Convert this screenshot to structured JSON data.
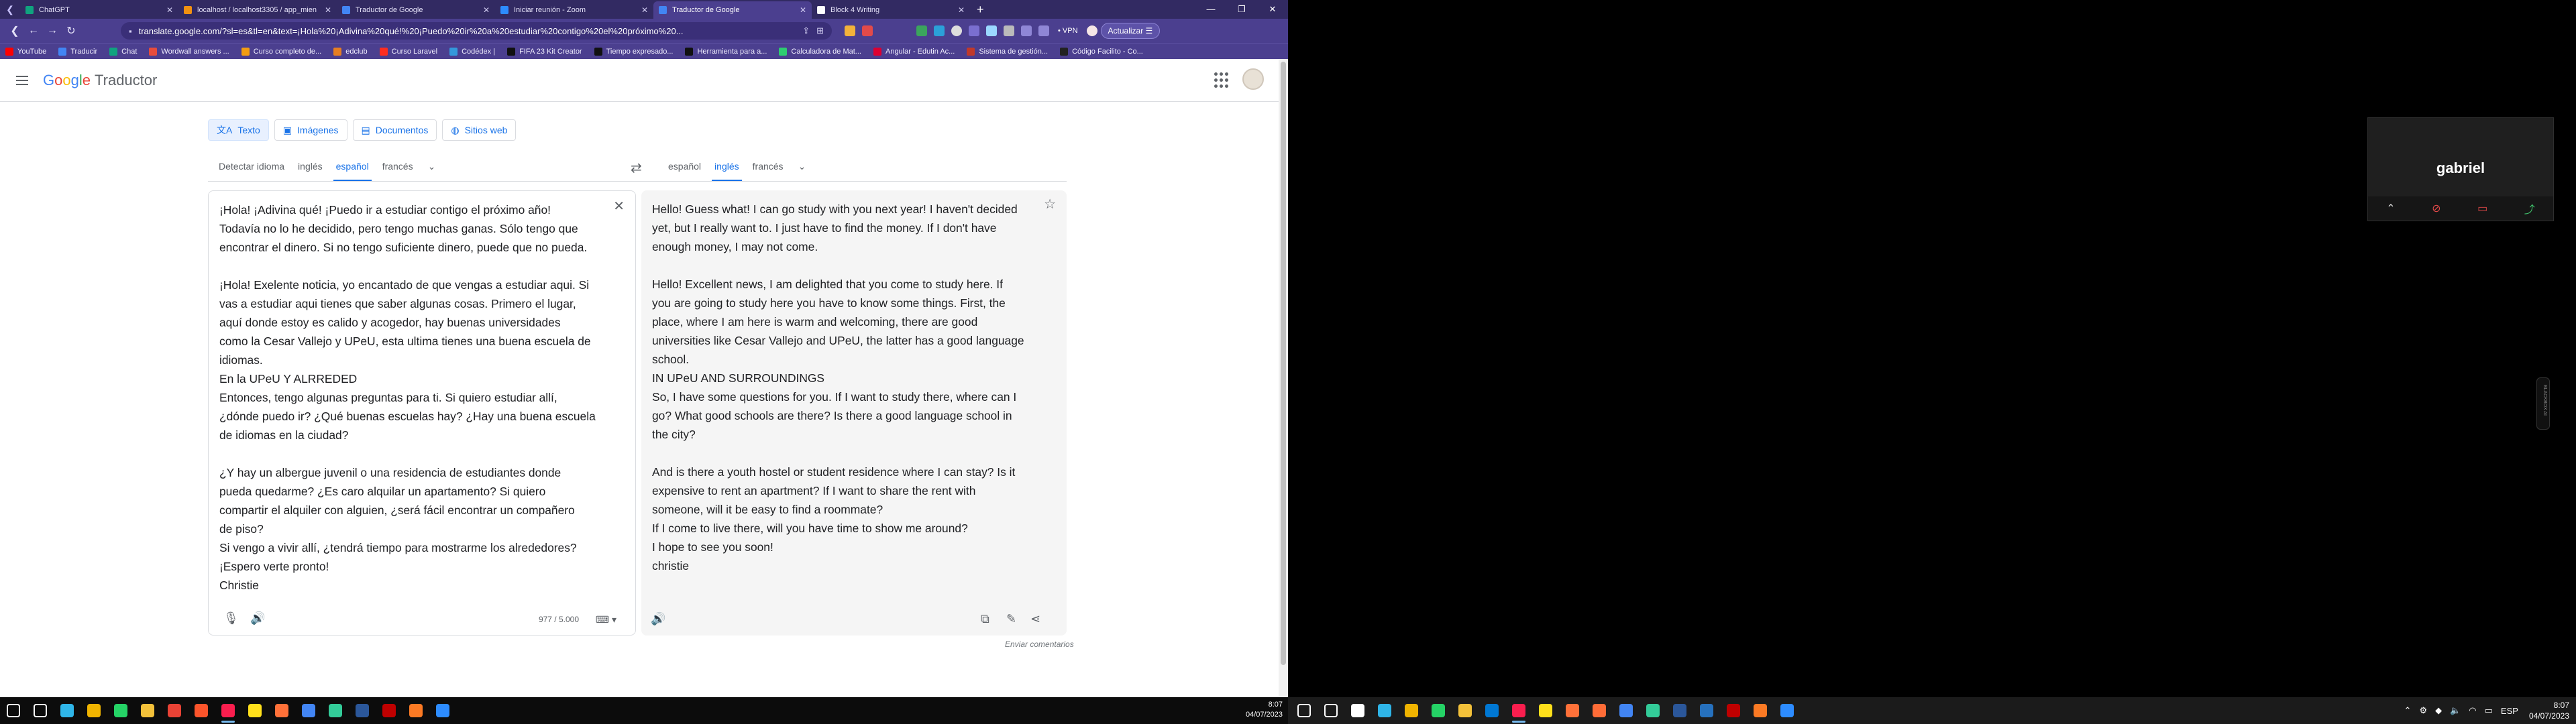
{
  "browser": {
    "tabs": [
      {
        "title": "ChatGPT",
        "color": "#10a37f",
        "active": false
      },
      {
        "title": "localhost / localhost3305 / app_mien",
        "color": "#f29111",
        "active": false
      },
      {
        "title": "Traductor de Google",
        "color": "#4285f4",
        "active": false
      },
      {
        "title": "Iniciar reunión - Zoom",
        "color": "#2d8cff",
        "active": false
      },
      {
        "title": "Traductor de Google",
        "color": "#4285f4",
        "active": true
      },
      {
        "title": "Block 4 Writing",
        "color": "#ffffff",
        "active": false
      }
    ],
    "url": "translate.google.com/?sl=es&tl=en&text=¡Hola%20¡Adivina%20qué!%20¡Puedo%20ir%20a%20estudiar%20contigo%20el%20próximo%20...",
    "vpn_label": "• VPN",
    "update_label": "Actualizar",
    "bookmarks": [
      {
        "label": "YouTube",
        "color": "#ff0000"
      },
      {
        "label": "Traducir",
        "color": "#4285f4"
      },
      {
        "label": "Chat",
        "color": "#10a37f"
      },
      {
        "label": "Wordwall answers ...",
        "color": "#e74c3c"
      },
      {
        "label": "Curso completo de...",
        "color": "#f39c12"
      },
      {
        "label": "edclub",
        "color": "#e67e22"
      },
      {
        "label": "Curso Laravel",
        "color": "#ff2d20"
      },
      {
        "label": "Codédex |",
        "color": "#3498db"
      },
      {
        "label": "FIFA 23 Kit Creator",
        "color": "#111111"
      },
      {
        "label": "Tiempo expresado...",
        "color": "#111111"
      },
      {
        "label": "Herramienta para a...",
        "color": "#111111"
      },
      {
        "label": "Calculadora de Mat...",
        "color": "#2ecc71"
      },
      {
        "label": "Angular - Edutin Ac...",
        "color": "#dd0031"
      },
      {
        "label": "Sistema de gestión...",
        "color": "#c0392b"
      },
      {
        "label": "Código Facilito - Co...",
        "color": "#222222"
      }
    ]
  },
  "gt": {
    "logo": {
      "g": "G",
      "o1": "o",
      "o2": "o",
      "g2": "g",
      "l": "l",
      "e": "e",
      "product": "Traductor"
    },
    "modes": [
      "Texto",
      "Imágenes",
      "Documentos",
      "Sitios web"
    ],
    "source_langs": [
      "Detectar idioma",
      "inglés",
      "español",
      "francés"
    ],
    "target_langs": [
      "español",
      "inglés",
      "francés"
    ],
    "source_text": "¡Hola! ¡Adivina qué! ¡Puedo ir a estudiar contigo el próximo año!\nTodavía no lo he decidido, pero tengo muchas ganas. Sólo tengo que\nencontrar el dinero. Si no tengo suficiente dinero, puede que no pueda.\n\n¡Hola! Exelente noticia, yo encantado de que vengas a estudiar aqui. Si\nvas a estudiar aqui tienes que saber algunas cosas. Primero el lugar,\naquí donde estoy es calido y acogedor, hay buenas universidades\ncomo la Cesar Vallejo y UPeU, esta ultima tienes una buena escuela de\nidiomas.\nEn la UPeU Y ALRREDED\nEntonces, tengo algunas preguntas para ti. Si quiero estudiar allí,\n¿dónde puedo ir? ¿Qué buenas escuelas hay? ¿Hay una buena escuela\nde idiomas en la ciudad?\n\n¿Y hay un albergue juvenil o una residencia de estudiantes donde\npueda quedarme? ¿Es caro alquilar un apartamento? Si quiero\ncompartir el alquiler con alguien, ¿será fácil encontrar un compañero\nde piso?\nSi vengo a vivir allí, ¿tendrá tiempo para mostrarme los alrededores?\n¡Espero verte pronto!\nChristie",
    "target_text": "Hello! Guess what! I can go study with you next year! I haven't decided\nyet, but I really want to. I just have to find the money. If I don't have\nenough money, I may not come.\n\nHello! Excellent news, I am delighted that you come to study here. If\nyou are going to study here you have to know some things. First, the\nplace, where I am here is warm and welcoming, there are good\nuniversities like Cesar Vallejo and UPeU, the latter has a good language\nschool.\nIN UPeU AND SURROUNDINGS\nSo, I have some questions for you. If I want to study there, where can I\ngo? What good schools are there? Is there a good language school in\nthe city?\n\nAnd is there a youth hostel or student residence where I can stay? Is it\nexpensive to rent an apartment? If I want to share the rent with\nsomeone, will it be easy to find a roommate?\nIf I come to live there, will you have time to show me around?\nI hope to see you soon!\nchristie",
    "char_count": "977 / 5.000",
    "feedback": "Enviar comentarios"
  },
  "taskbar_left": {
    "date": "04/07/2023",
    "time": "8:07",
    "icons": [
      {
        "name": "windows-start-icon",
        "color": "#ffffff"
      },
      {
        "name": "search-icon",
        "color": "#ffffff"
      },
      {
        "name": "bing-icon",
        "color": "#2fb5e8"
      },
      {
        "name": "file-icon",
        "color": "#f0b400"
      },
      {
        "name": "whatsapp-icon",
        "color": "#25d366"
      },
      {
        "name": "folder-icon",
        "color": "#f3c13a"
      },
      {
        "name": "chrome-icon",
        "color": "#e94235"
      },
      {
        "name": "brave-icon",
        "color": "#fb542b"
      },
      {
        "name": "opera-gx-icon",
        "color": "#fa1e4e"
      },
      {
        "name": "norton-icon",
        "color": "#ffe01b"
      },
      {
        "name": "firefox-icon",
        "color": "#ff7139"
      },
      {
        "name": "chrome-beta-icon",
        "color": "#4285f4"
      },
      {
        "name": "terminal-icon",
        "color": "#3c9"
      },
      {
        "name": "word-icon",
        "color": "#2b579a"
      },
      {
        "name": "filezilla-icon",
        "color": "#bf0000"
      },
      {
        "name": "xampp-icon",
        "color": "#fb7a24"
      },
      {
        "name": "zoom-icon",
        "color": "#2d8cff"
      }
    ]
  },
  "zoom": {
    "participant_name": "gabriel",
    "participant_small": "gabriel",
    "side_label": "BLACKBOX AI"
  },
  "taskbar_right": {
    "lang": "ESP",
    "time": "8:07",
    "date": "04/07/2023",
    "icons": [
      {
        "name": "windows-start-icon",
        "color": "#ffffff"
      },
      {
        "name": "search-icon",
        "color": "#ffffff"
      },
      {
        "name": "task-view-icon",
        "color": "#ffffff"
      },
      {
        "name": "bing-icon",
        "color": "#2fb5e8"
      },
      {
        "name": "file-icon",
        "color": "#f0b400"
      },
      {
        "name": "whatsapp-icon",
        "color": "#25d366"
      },
      {
        "name": "folder-icon",
        "color": "#f3c13a"
      },
      {
        "name": "vscode-icon",
        "color": "#0078d4"
      },
      {
        "name": "opera-gx-icon",
        "color": "#fa1e4e"
      },
      {
        "name": "norton-icon",
        "color": "#ffe01b"
      },
      {
        "name": "firefox-icon",
        "color": "#ff7139"
      },
      {
        "name": "postman-icon",
        "color": "#ff6c37"
      },
      {
        "name": "chrome-beta-icon",
        "color": "#4285f4"
      },
      {
        "name": "terminal-icon",
        "color": "#3c9"
      },
      {
        "name": "word-icon",
        "color": "#2b579a"
      },
      {
        "name": "powershell-icon",
        "color": "#2671be"
      },
      {
        "name": "filezilla-icon",
        "color": "#bf0000"
      },
      {
        "name": "xampp-icon",
        "color": "#fb7a24"
      },
      {
        "name": "zoom-icon",
        "color": "#2d8cff"
      }
    ]
  }
}
